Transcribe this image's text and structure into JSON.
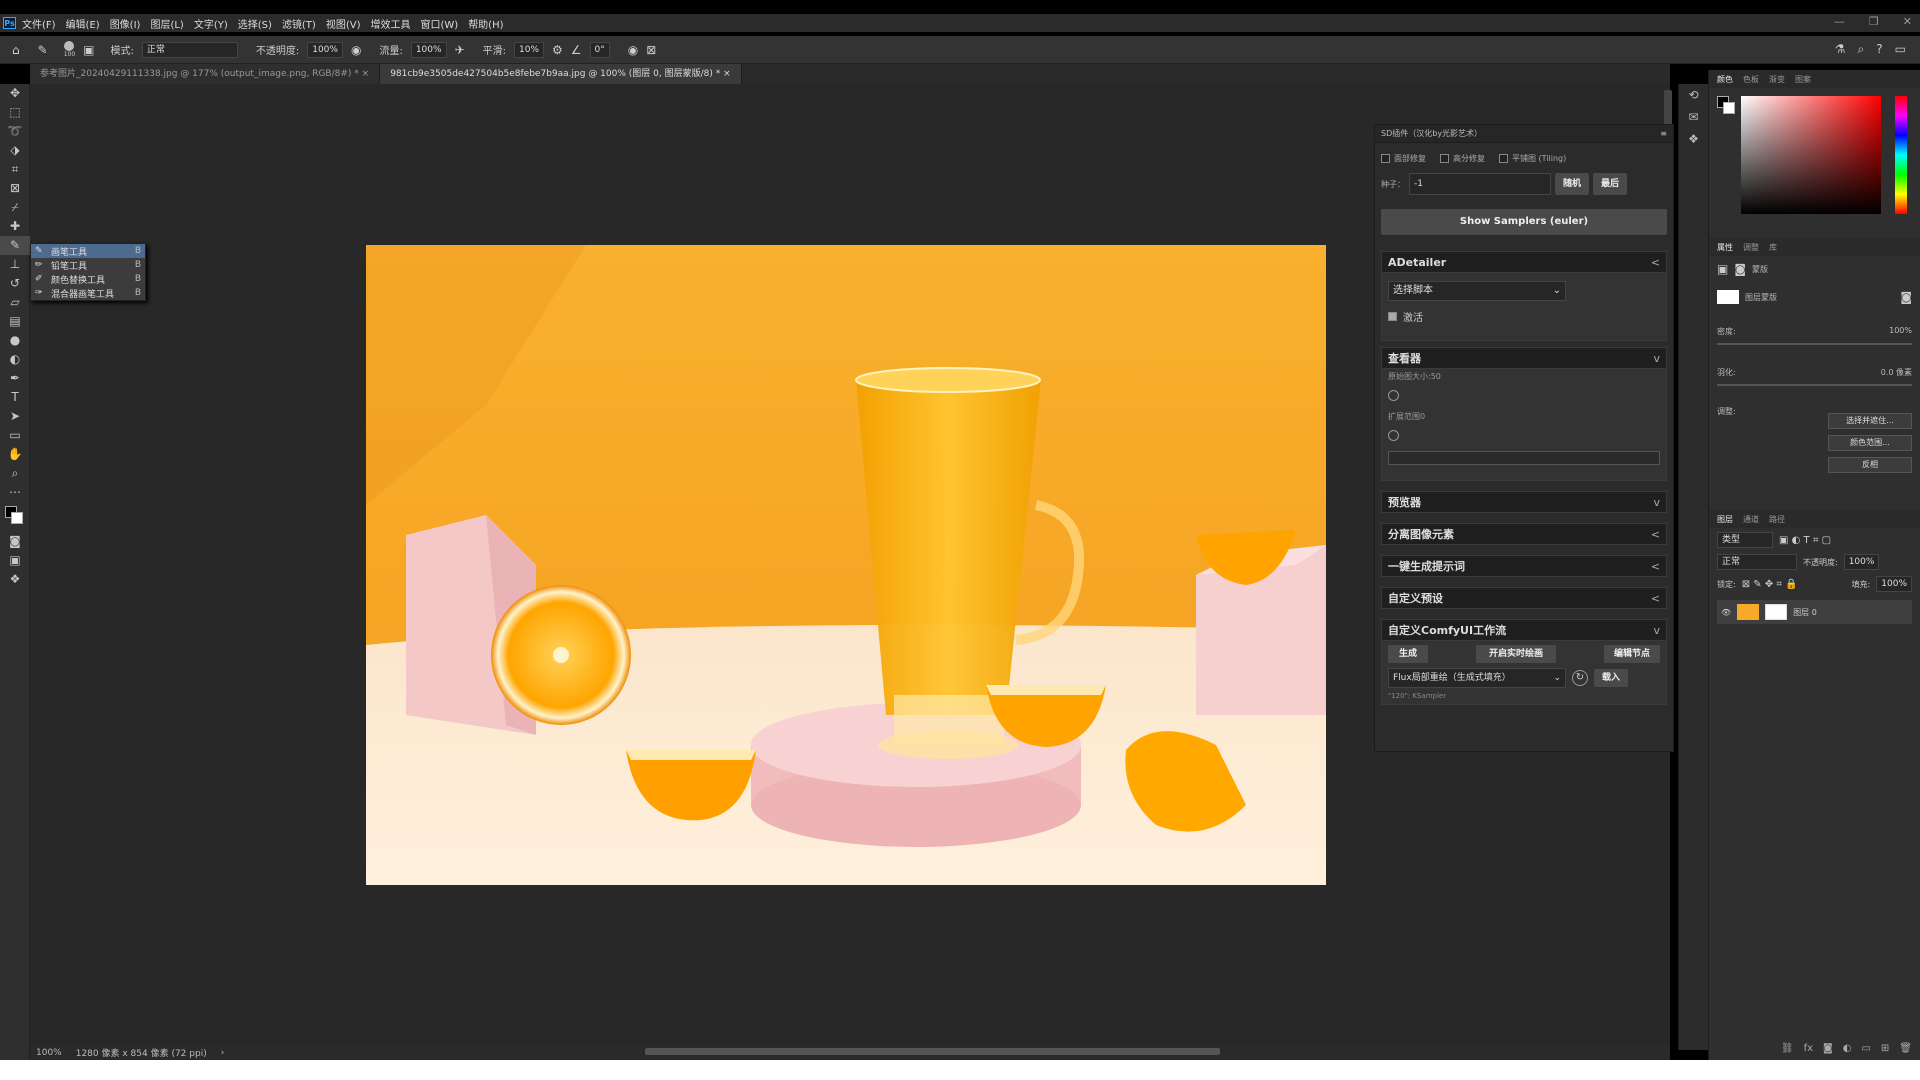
{
  "app": {
    "logo": "Ps"
  },
  "menu": [
    "文件(F)",
    "编辑(E)",
    "图像(I)",
    "图层(L)",
    "文字(Y)",
    "选择(S)",
    "滤镜(T)",
    "视图(V)",
    "增效工具",
    "窗口(W)",
    "帮助(H)"
  ],
  "window_controls": [
    "—",
    "❐",
    "✕"
  ],
  "options": {
    "brush_size": "100",
    "mode_label": "模式:",
    "mode_value": "正常",
    "opacity_label": "不透明度:",
    "opacity_value": "100%",
    "flow_label": "流量:",
    "flow_value": "100%",
    "smooth_label": "平滑:",
    "smooth_value": "10%",
    "angle_value": "0°"
  },
  "tabs": [
    {
      "label": "参考图片_20240429111338.jpg @ 177% (output_image.png, RGB/8#) *",
      "close": "×"
    },
    {
      "label": "981cb9e3505de427504b5e8febe7b9aa.jpg @ 100% (图层 0, 图层蒙版/8) *",
      "close": "×"
    }
  ],
  "flyout": [
    {
      "icon": "✎",
      "label": "画笔工具",
      "key": "B"
    },
    {
      "icon": "✏",
      "label": "铅笔工具",
      "key": "B"
    },
    {
      "icon": "✐",
      "label": "颜色替换工具",
      "key": "B"
    },
    {
      "icon": "✑",
      "label": "混合器画笔工具",
      "key": "B"
    }
  ],
  "status": {
    "zoom": "100%",
    "doc_info": "1280 像素 x 854 像素 (72 ppi)",
    "arrow": "›"
  },
  "sd_panel": {
    "title": "SD插件（汉化by光影艺术）",
    "checks": [
      "面部修复",
      "高分修复",
      "平铺图 (Tiling)"
    ],
    "seed_label": "种子：",
    "seed_value": "-1",
    "random_btn": "随机",
    "last_btn": "最后",
    "show_samplers": "Show Samplers (euler)",
    "adetailer": "ADetailer",
    "script_select": "选择脚本",
    "activate": "激活",
    "viewer": "查看器",
    "viewer_sub1": "原始图大小:50",
    "viewer_sub2": "扩展范围0",
    "previewer": "预览器",
    "separate": "分离图像元素",
    "one_click": "一键生成提示词",
    "custom_preset": "自定义预设",
    "comfy": "自定义ComfyUI工作流",
    "generate_btn": "生成",
    "realtime_btn": "开启实时绘画",
    "edit_nodes_btn": "编辑节点",
    "workflow_select": "Flux局部重绘（生成式填充）",
    "load_btn": "载入",
    "ksampler": "\"120\": KSampler",
    "chev_left": "<",
    "chev_down": "v"
  },
  "color_panel": {
    "tabs": [
      "颜色",
      "色板",
      "渐变",
      "图案"
    ]
  },
  "props_panel": {
    "tabs": [
      "属性",
      "调整",
      "库"
    ],
    "mask_label": "蒙版",
    "layer_mask": "图层蒙版",
    "density_label": "密度:",
    "density_value": "100%",
    "feather_label": "羽化:",
    "feather_value": "0.0 像素",
    "adjust_label": "调整:",
    "select_mask_btn": "选择并遮住...",
    "color_range_btn": "颜色范围...",
    "invert_btn": "反相"
  },
  "layers_panel": {
    "tabs": [
      "图层",
      "通道",
      "路径"
    ],
    "kind_label": "类型",
    "blend_mode": "正常",
    "opacity_label": "不透明度:",
    "opacity_value": "100%",
    "lock_label": "锁定:",
    "fill_label": "填充:",
    "fill_value": "100%",
    "layer_name": "图层 0"
  },
  "colors": {
    "accent": "#31a8ff",
    "fg": "#000000",
    "bg": "#ffffff",
    "photo_bg": "#f7a929"
  }
}
